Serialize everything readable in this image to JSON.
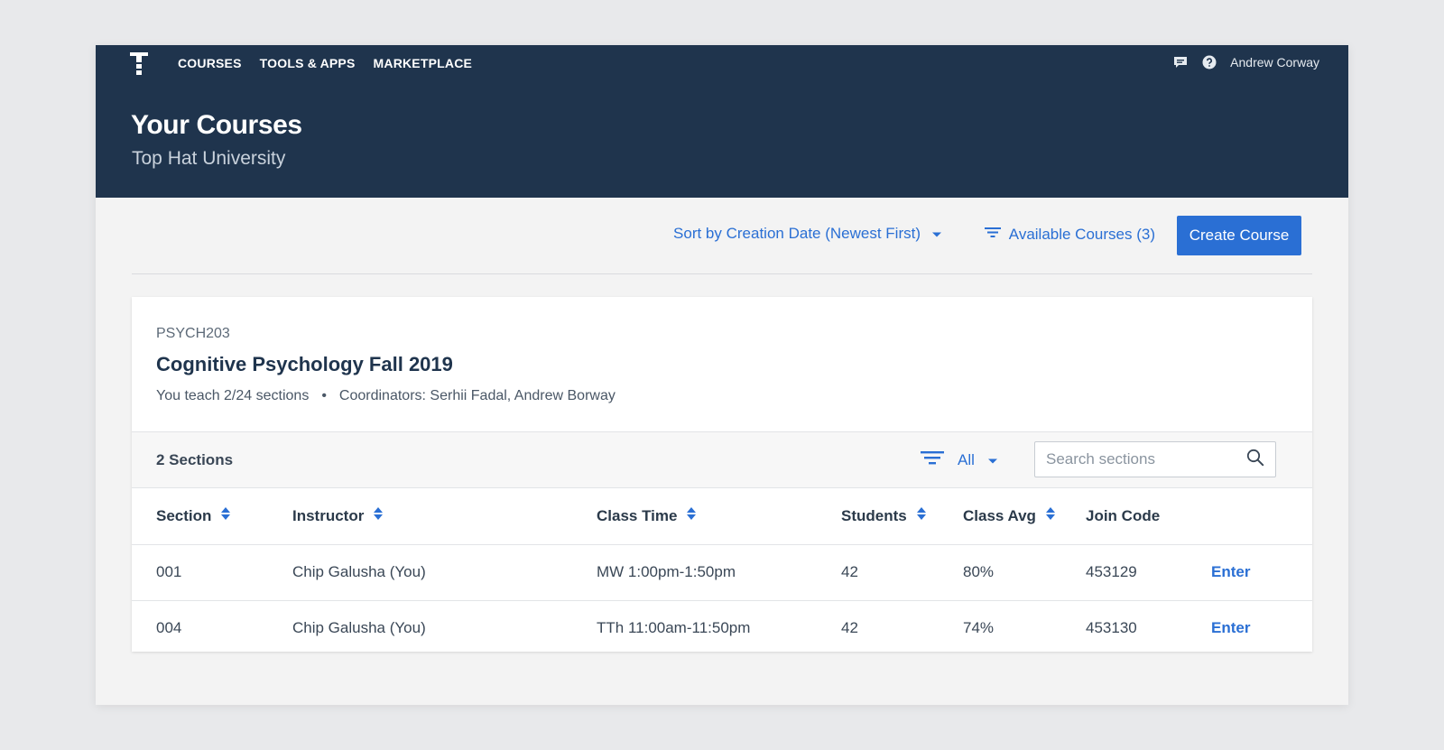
{
  "nav": {
    "logo": "tophat-logo-icon",
    "items": [
      "COURSES",
      "TOOLS & APPS",
      "MARKETPLACE"
    ],
    "icons": [
      "chat-icon",
      "help-icon"
    ],
    "user_name": "Andrew Corway"
  },
  "header": {
    "title": "Your Courses",
    "subtitle": "Top Hat University"
  },
  "toolbar": {
    "sort_label": "Sort by Creation Date (Newest First)",
    "filter_label": "Available Courses (3)",
    "create_label": "Create Course"
  },
  "course": {
    "code": "PSYCH203",
    "name": "Cognitive Psychology Fall 2019",
    "teach_info": "You teach 2/24 sections",
    "separator": "•",
    "coordinators": "Coordinators: Serhii Fadal, Andrew Borway"
  },
  "sections": {
    "count_label": "2 Sections",
    "filter_value": "All",
    "search_placeholder": "Search sections",
    "columns": [
      "Section",
      "Instructor",
      "Class Time",
      "Students",
      "Class Avg",
      "Join Code"
    ],
    "rows": [
      {
        "section": "001",
        "instructor": "Chip Galusha (You)",
        "time": "MW 1:00pm-1:50pm",
        "students": "42",
        "avg": "80%",
        "code": "453129",
        "action": "Enter"
      },
      {
        "section": "004",
        "instructor": "Chip Galusha (You)",
        "time": "TTh 11:00am-11:50pm",
        "students": "42",
        "avg": "74%",
        "code": "453130",
        "action": "Enter"
      }
    ]
  },
  "colors": {
    "header_bg": "#1f344d",
    "accent": "#2a6fd4",
    "page_bg": "#f3f3f3"
  }
}
